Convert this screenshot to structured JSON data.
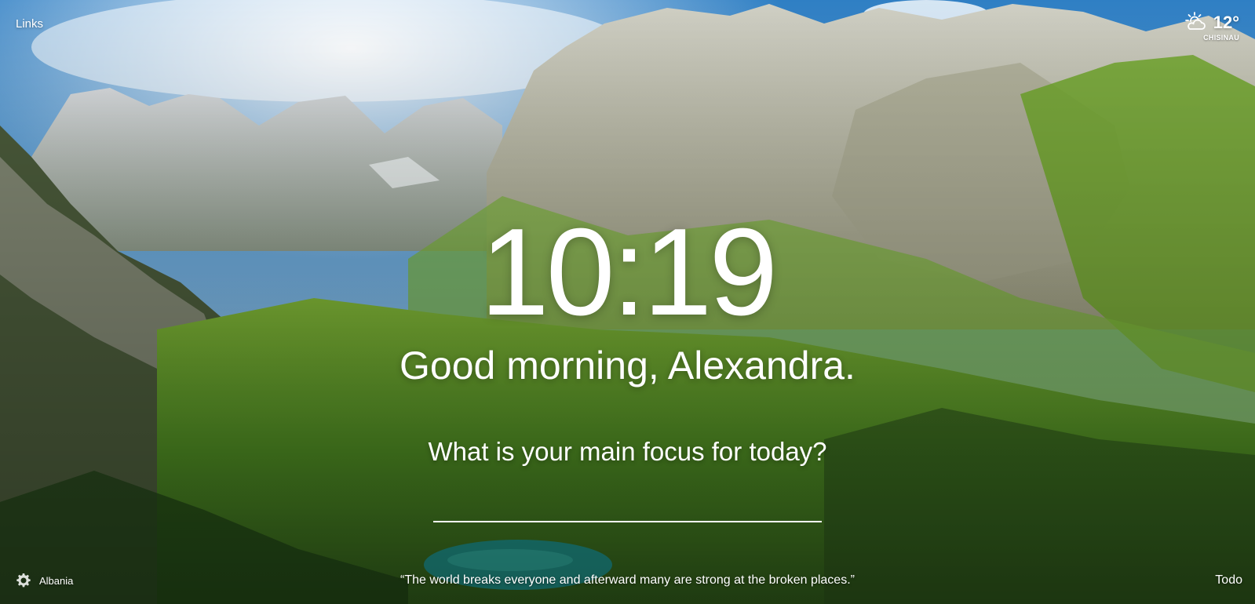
{
  "top_left": {
    "links_label": "Links"
  },
  "weather": {
    "icon": "partly-cloudy-sun-icon",
    "temperature": "12°",
    "location": "CHISINAU"
  },
  "center": {
    "time": "10:19",
    "greeting": "Good morning, Alexandra.",
    "focus_question": "What is your main focus for today?",
    "focus_input_value": ""
  },
  "bottom": {
    "settings_icon": "gear-icon",
    "photo_location": "Albania",
    "quote": "“The world breaks everyone and afterward many are strong at the broken places.”",
    "todo_label": "Todo"
  },
  "colors": {
    "text": "#ffffff",
    "sky_top": "#2f7fc4",
    "sky_light": "#bfe1f5",
    "rock": "#b9b9a9",
    "grass": "#6aa32a",
    "lake": "#1f8e84"
  }
}
